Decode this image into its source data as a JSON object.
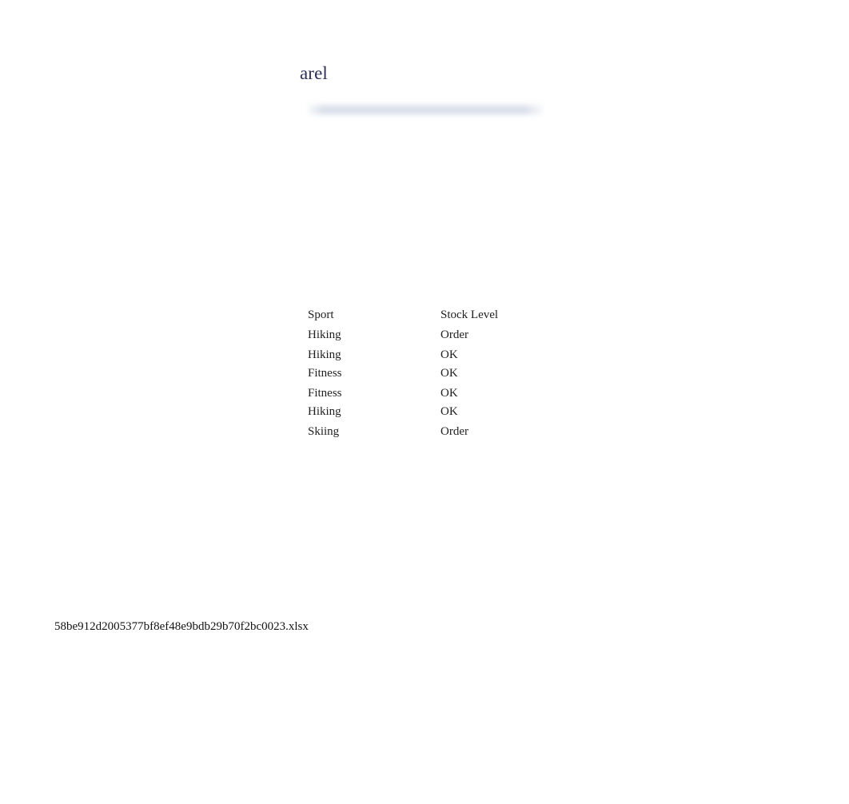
{
  "document": {
    "title": "arel",
    "redacted_subtitle": {
      "present": true,
      "style": "blurred-bar",
      "color": "#d4dae6"
    },
    "file_name": "58be912d2005377bf8ef48e9bdb29b70f2bc0023.xlsx"
  },
  "table": {
    "columns": [
      "Sport",
      "Stock Level"
    ],
    "rows": [
      {
        "sport": "Hiking",
        "stock_level": "Order"
      },
      {
        "sport": "Hiking",
        "stock_level": "OK"
      },
      {
        "sport": "Fitness",
        "stock_level": "OK"
      },
      {
        "sport": "Fitness",
        "stock_level": "OK"
      },
      {
        "sport": "Hiking",
        "stock_level": "OK"
      },
      {
        "sport": "Skiing",
        "stock_level": "Order"
      }
    ]
  },
  "colors": {
    "title": "#2b3055",
    "body_text": "#1f1f1f",
    "background": "#ffffff",
    "redacted_bar": "#d4dae6"
  }
}
